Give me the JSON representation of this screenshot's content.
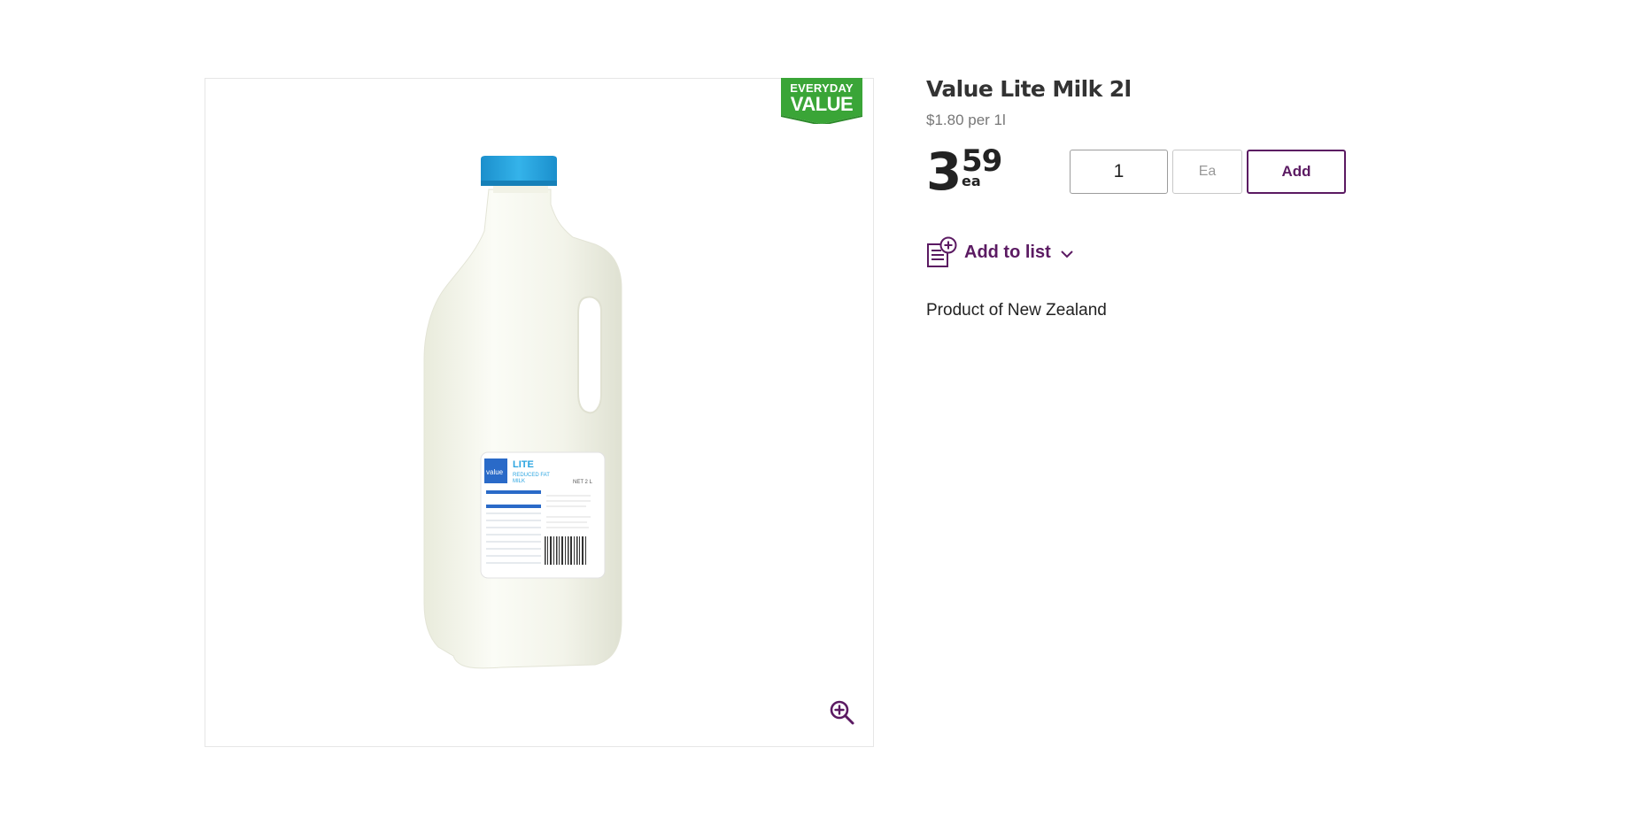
{
  "product": {
    "badge": {
      "line1": "EVERYDAY",
      "line2": "VALUE",
      "color": "#3aa537"
    },
    "image_alt": "Value Lite Milk 2l",
    "title": "Value Lite Milk 2l",
    "unit_price": "$1.80 per 1l",
    "price": {
      "dollars": "3",
      "cents": "59",
      "unit": "ea"
    },
    "origin": "Product of New Zealand"
  },
  "purchase": {
    "quantity": "1",
    "unit": "Ea",
    "add_label": "Add"
  },
  "list": {
    "label": "Add to list"
  },
  "icons": {
    "zoom": "zoom-in-icon",
    "list": "add-to-list-icon",
    "chevron": "chevron-down-icon"
  },
  "colors": {
    "accent": "#5b1a62",
    "cap": "#27a6e1"
  }
}
